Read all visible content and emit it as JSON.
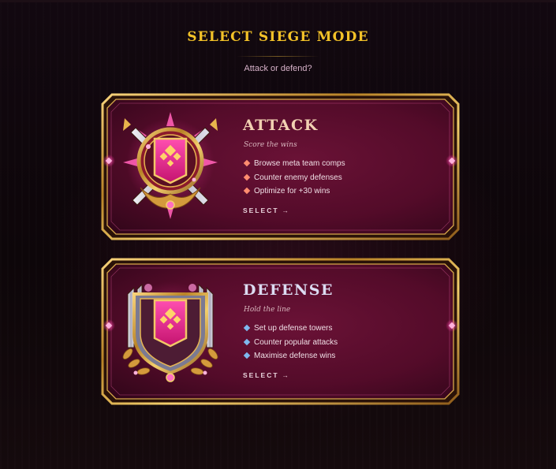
{
  "header": {
    "title": "SELECT SIEGE MODE",
    "subtitle": "Attack or defend?"
  },
  "colors": {
    "title_gold": "#f3c228",
    "card_bg": "#5a0d2c",
    "frame_gold": "#c9963a",
    "accent_pink": "#ff4fa8",
    "attack_bullet": "#ff8d6f",
    "defense_bullet": "#7fb8ee"
  },
  "modes": [
    {
      "title": "ATTACK",
      "tagline": "Score the wins",
      "features": [
        "Browse meta team comps",
        "Counter enemy defenses",
        "Optimize for +30 wins"
      ],
      "select_label": "SELECT",
      "arrow": "→",
      "emblem_icon": "crossed-swords-banner-icon"
    },
    {
      "title": "DEFENSE",
      "tagline": "Hold the line",
      "features": [
        "Set up defense towers",
        "Counter popular attacks",
        "Maximise defense wins"
      ],
      "select_label": "SELECT",
      "arrow": "→",
      "emblem_icon": "shield-laurel-banner-icon"
    }
  ]
}
